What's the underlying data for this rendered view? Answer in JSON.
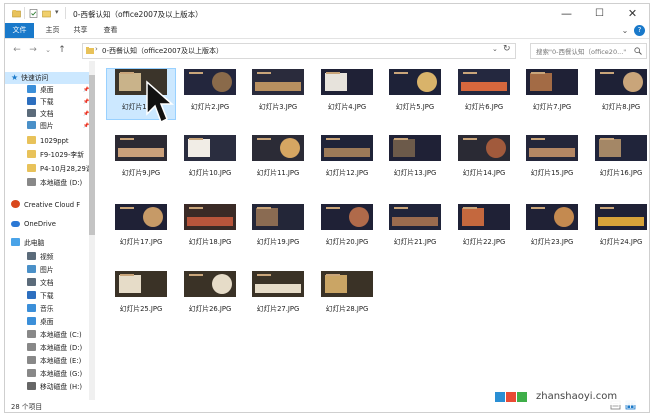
{
  "window": {
    "title": "0-西餐认知（office2007及以上版本）",
    "controls": {
      "minimize": "—",
      "maximize": "☐",
      "close": "✕"
    }
  },
  "ribbon": {
    "tabs": [
      "文件",
      "主页",
      "共享",
      "查看"
    ]
  },
  "address": {
    "path": "0-西餐认知（office2007及以上版本）",
    "search_placeholder": "搜索\"0-西餐认知（office20...\""
  },
  "nav": {
    "quick_access": "快速访问",
    "items": [
      {
        "label": "桌面",
        "pinned": true
      },
      {
        "label": "下载",
        "pinned": true
      },
      {
        "label": "文档",
        "pinned": true
      },
      {
        "label": "图片",
        "pinned": true
      },
      {
        "label": "1029ppt"
      },
      {
        "label": "F9-1029-李新"
      },
      {
        "label": "P4-10月28,29课"
      },
      {
        "label": "本地磁盘 (D:)"
      }
    ],
    "creative_cloud": "Creative Cloud F",
    "onedrive": "OneDrive",
    "this_pc": "此电脑",
    "pc_items": [
      "视频",
      "图片",
      "文档",
      "下载",
      "音乐",
      "桌面",
      "本地磁盘 (C:)",
      "本地磁盘 (D:)",
      "本地磁盘 (E:)",
      "本地磁盘 (G:)",
      "移动磁盘 (H:)"
    ]
  },
  "files": [
    {
      "name": "幻灯片1.JPG",
      "bg": "#3b342a",
      "accent": "#c9b38a"
    },
    {
      "name": "幻灯片2.JPG",
      "bg": "#23263d",
      "accent": "#8a6a4a"
    },
    {
      "name": "幻灯片3.JPG",
      "bg": "#2a2b3c",
      "accent": "#b89060"
    },
    {
      "name": "幻灯片4.JPG",
      "bg": "#1f2136",
      "accent": "#e7e3dc"
    },
    {
      "name": "幻灯片5.JPG",
      "bg": "#1e2238",
      "accent": "#d9b36a"
    },
    {
      "name": "幻灯片6.JPG",
      "bg": "#24283f",
      "accent": "#d6673d"
    },
    {
      "name": "幻灯片7.JPG",
      "bg": "#1f2136",
      "accent": "#a36b45"
    },
    {
      "name": "幻灯片8.JPG",
      "bg": "#1e2136",
      "accent": "#c9a57a"
    },
    {
      "name": "幻灯片9.JPG",
      "bg": "#2c2a33",
      "accent": "#caa07a"
    },
    {
      "name": "幻灯片10.JPG",
      "bg": "#2a2d3f",
      "accent": "#f1ede6"
    },
    {
      "name": "幻灯片11.JPG",
      "bg": "#2b2b36",
      "accent": "#d6a662"
    },
    {
      "name": "幻灯片12.JPG",
      "bg": "#1f2338",
      "accent": "#9c7a58"
    },
    {
      "name": "幻灯片13.JPG",
      "bg": "#1f2136",
      "accent": "#6c5a4a"
    },
    {
      "name": "幻灯片14.JPG",
      "bg": "#2a2a34",
      "accent": "#a15a3c"
    },
    {
      "name": "幻灯片15.JPG",
      "bg": "#24263a",
      "accent": "#b48764"
    },
    {
      "name": "幻灯片16.JPG",
      "bg": "#20243a",
      "accent": "#a48766"
    },
    {
      "name": "幻灯片17.JPG",
      "bg": "#1f2136",
      "accent": "#c69a67"
    },
    {
      "name": "幻灯片18.JPG",
      "bg": "#3a2a26",
      "accent": "#b8553b"
    },
    {
      "name": "幻灯片19.JPG",
      "bg": "#232638",
      "accent": "#8a6b52"
    },
    {
      "name": "幻灯片20.JPG",
      "bg": "#1f2136",
      "accent": "#b06a4a"
    },
    {
      "name": "幻灯片21.JPG",
      "bg": "#20243a",
      "accent": "#9a6b4e"
    },
    {
      "name": "幻灯片22.JPG",
      "bg": "#1f2136",
      "accent": "#c4683e"
    },
    {
      "name": "幻灯片23.JPG",
      "bg": "#1f2136",
      "accent": "#c48a50"
    },
    {
      "name": "幻灯片24.JPG",
      "bg": "#1f2136",
      "accent": "#d7a33a"
    },
    {
      "name": "幻灯片25.JPG",
      "bg": "#3a3226",
      "accent": "#e6dcc8"
    },
    {
      "name": "幻灯片26.JPG",
      "bg": "#3a3226",
      "accent": "#e6dcc8"
    },
    {
      "name": "幻灯片27.JPG",
      "bg": "#3a3226",
      "accent": "#e6dcc8"
    },
    {
      "name": "幻灯片28.JPG",
      "bg": "#3a3226",
      "accent": "#caa565"
    }
  ],
  "status": {
    "count": "28 个项目"
  },
  "watermark": {
    "text": "zhanshaoyi.com"
  },
  "colors": {
    "accent": "#1979ca",
    "selection": "#cce8ff"
  }
}
